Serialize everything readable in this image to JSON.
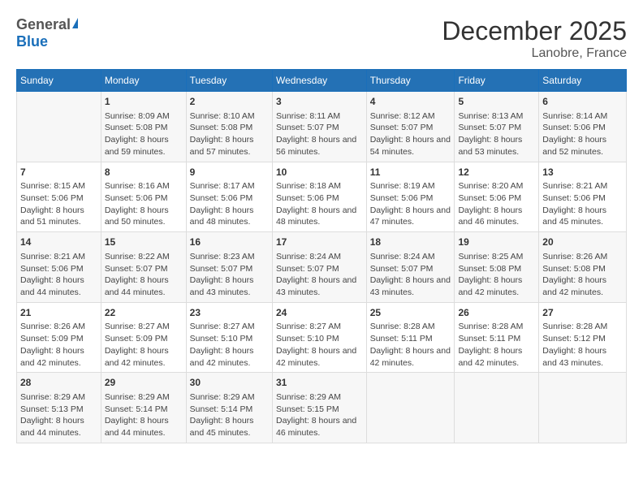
{
  "header": {
    "logo_general": "General",
    "logo_blue": "Blue",
    "title": "December 2025",
    "subtitle": "Lanobre, France"
  },
  "days_of_week": [
    "Sunday",
    "Monday",
    "Tuesday",
    "Wednesday",
    "Thursday",
    "Friday",
    "Saturday"
  ],
  "weeks": [
    [
      {
        "day": "",
        "sunrise": "",
        "sunset": "",
        "daylight": ""
      },
      {
        "day": "1",
        "sunrise": "Sunrise: 8:09 AM",
        "sunset": "Sunset: 5:08 PM",
        "daylight": "Daylight: 8 hours and 59 minutes."
      },
      {
        "day": "2",
        "sunrise": "Sunrise: 8:10 AM",
        "sunset": "Sunset: 5:08 PM",
        "daylight": "Daylight: 8 hours and 57 minutes."
      },
      {
        "day": "3",
        "sunrise": "Sunrise: 8:11 AM",
        "sunset": "Sunset: 5:07 PM",
        "daylight": "Daylight: 8 hours and 56 minutes."
      },
      {
        "day": "4",
        "sunrise": "Sunrise: 8:12 AM",
        "sunset": "Sunset: 5:07 PM",
        "daylight": "Daylight: 8 hours and 54 minutes."
      },
      {
        "day": "5",
        "sunrise": "Sunrise: 8:13 AM",
        "sunset": "Sunset: 5:07 PM",
        "daylight": "Daylight: 8 hours and 53 minutes."
      },
      {
        "day": "6",
        "sunrise": "Sunrise: 8:14 AM",
        "sunset": "Sunset: 5:06 PM",
        "daylight": "Daylight: 8 hours and 52 minutes."
      }
    ],
    [
      {
        "day": "7",
        "sunrise": "Sunrise: 8:15 AM",
        "sunset": "Sunset: 5:06 PM",
        "daylight": "Daylight: 8 hours and 51 minutes."
      },
      {
        "day": "8",
        "sunrise": "Sunrise: 8:16 AM",
        "sunset": "Sunset: 5:06 PM",
        "daylight": "Daylight: 8 hours and 50 minutes."
      },
      {
        "day": "9",
        "sunrise": "Sunrise: 8:17 AM",
        "sunset": "Sunset: 5:06 PM",
        "daylight": "Daylight: 8 hours and 48 minutes."
      },
      {
        "day": "10",
        "sunrise": "Sunrise: 8:18 AM",
        "sunset": "Sunset: 5:06 PM",
        "daylight": "Daylight: 8 hours and 48 minutes."
      },
      {
        "day": "11",
        "sunrise": "Sunrise: 8:19 AM",
        "sunset": "Sunset: 5:06 PM",
        "daylight": "Daylight: 8 hours and 47 minutes."
      },
      {
        "day": "12",
        "sunrise": "Sunrise: 8:20 AM",
        "sunset": "Sunset: 5:06 PM",
        "daylight": "Daylight: 8 hours and 46 minutes."
      },
      {
        "day": "13",
        "sunrise": "Sunrise: 8:21 AM",
        "sunset": "Sunset: 5:06 PM",
        "daylight": "Daylight: 8 hours and 45 minutes."
      }
    ],
    [
      {
        "day": "14",
        "sunrise": "Sunrise: 8:21 AM",
        "sunset": "Sunset: 5:06 PM",
        "daylight": "Daylight: 8 hours and 44 minutes."
      },
      {
        "day": "15",
        "sunrise": "Sunrise: 8:22 AM",
        "sunset": "Sunset: 5:07 PM",
        "daylight": "Daylight: 8 hours and 44 minutes."
      },
      {
        "day": "16",
        "sunrise": "Sunrise: 8:23 AM",
        "sunset": "Sunset: 5:07 PM",
        "daylight": "Daylight: 8 hours and 43 minutes."
      },
      {
        "day": "17",
        "sunrise": "Sunrise: 8:24 AM",
        "sunset": "Sunset: 5:07 PM",
        "daylight": "Daylight: 8 hours and 43 minutes."
      },
      {
        "day": "18",
        "sunrise": "Sunrise: 8:24 AM",
        "sunset": "Sunset: 5:07 PM",
        "daylight": "Daylight: 8 hours and 43 minutes."
      },
      {
        "day": "19",
        "sunrise": "Sunrise: 8:25 AM",
        "sunset": "Sunset: 5:08 PM",
        "daylight": "Daylight: 8 hours and 42 minutes."
      },
      {
        "day": "20",
        "sunrise": "Sunrise: 8:26 AM",
        "sunset": "Sunset: 5:08 PM",
        "daylight": "Daylight: 8 hours and 42 minutes."
      }
    ],
    [
      {
        "day": "21",
        "sunrise": "Sunrise: 8:26 AM",
        "sunset": "Sunset: 5:09 PM",
        "daylight": "Daylight: 8 hours and 42 minutes."
      },
      {
        "day": "22",
        "sunrise": "Sunrise: 8:27 AM",
        "sunset": "Sunset: 5:09 PM",
        "daylight": "Daylight: 8 hours and 42 minutes."
      },
      {
        "day": "23",
        "sunrise": "Sunrise: 8:27 AM",
        "sunset": "Sunset: 5:10 PM",
        "daylight": "Daylight: 8 hours and 42 minutes."
      },
      {
        "day": "24",
        "sunrise": "Sunrise: 8:27 AM",
        "sunset": "Sunset: 5:10 PM",
        "daylight": "Daylight: 8 hours and 42 minutes."
      },
      {
        "day": "25",
        "sunrise": "Sunrise: 8:28 AM",
        "sunset": "Sunset: 5:11 PM",
        "daylight": "Daylight: 8 hours and 42 minutes."
      },
      {
        "day": "26",
        "sunrise": "Sunrise: 8:28 AM",
        "sunset": "Sunset: 5:11 PM",
        "daylight": "Daylight: 8 hours and 42 minutes."
      },
      {
        "day": "27",
        "sunrise": "Sunrise: 8:28 AM",
        "sunset": "Sunset: 5:12 PM",
        "daylight": "Daylight: 8 hours and 43 minutes."
      }
    ],
    [
      {
        "day": "28",
        "sunrise": "Sunrise: 8:29 AM",
        "sunset": "Sunset: 5:13 PM",
        "daylight": "Daylight: 8 hours and 44 minutes."
      },
      {
        "day": "29",
        "sunrise": "Sunrise: 8:29 AM",
        "sunset": "Sunset: 5:14 PM",
        "daylight": "Daylight: 8 hours and 44 minutes."
      },
      {
        "day": "30",
        "sunrise": "Sunrise: 8:29 AM",
        "sunset": "Sunset: 5:14 PM",
        "daylight": "Daylight: 8 hours and 45 minutes."
      },
      {
        "day": "31",
        "sunrise": "Sunrise: 8:29 AM",
        "sunset": "Sunset: 5:15 PM",
        "daylight": "Daylight: 8 hours and 46 minutes."
      },
      {
        "day": "",
        "sunrise": "",
        "sunset": "",
        "daylight": ""
      },
      {
        "day": "",
        "sunrise": "",
        "sunset": "",
        "daylight": ""
      },
      {
        "day": "",
        "sunrise": "",
        "sunset": "",
        "daylight": ""
      }
    ]
  ]
}
